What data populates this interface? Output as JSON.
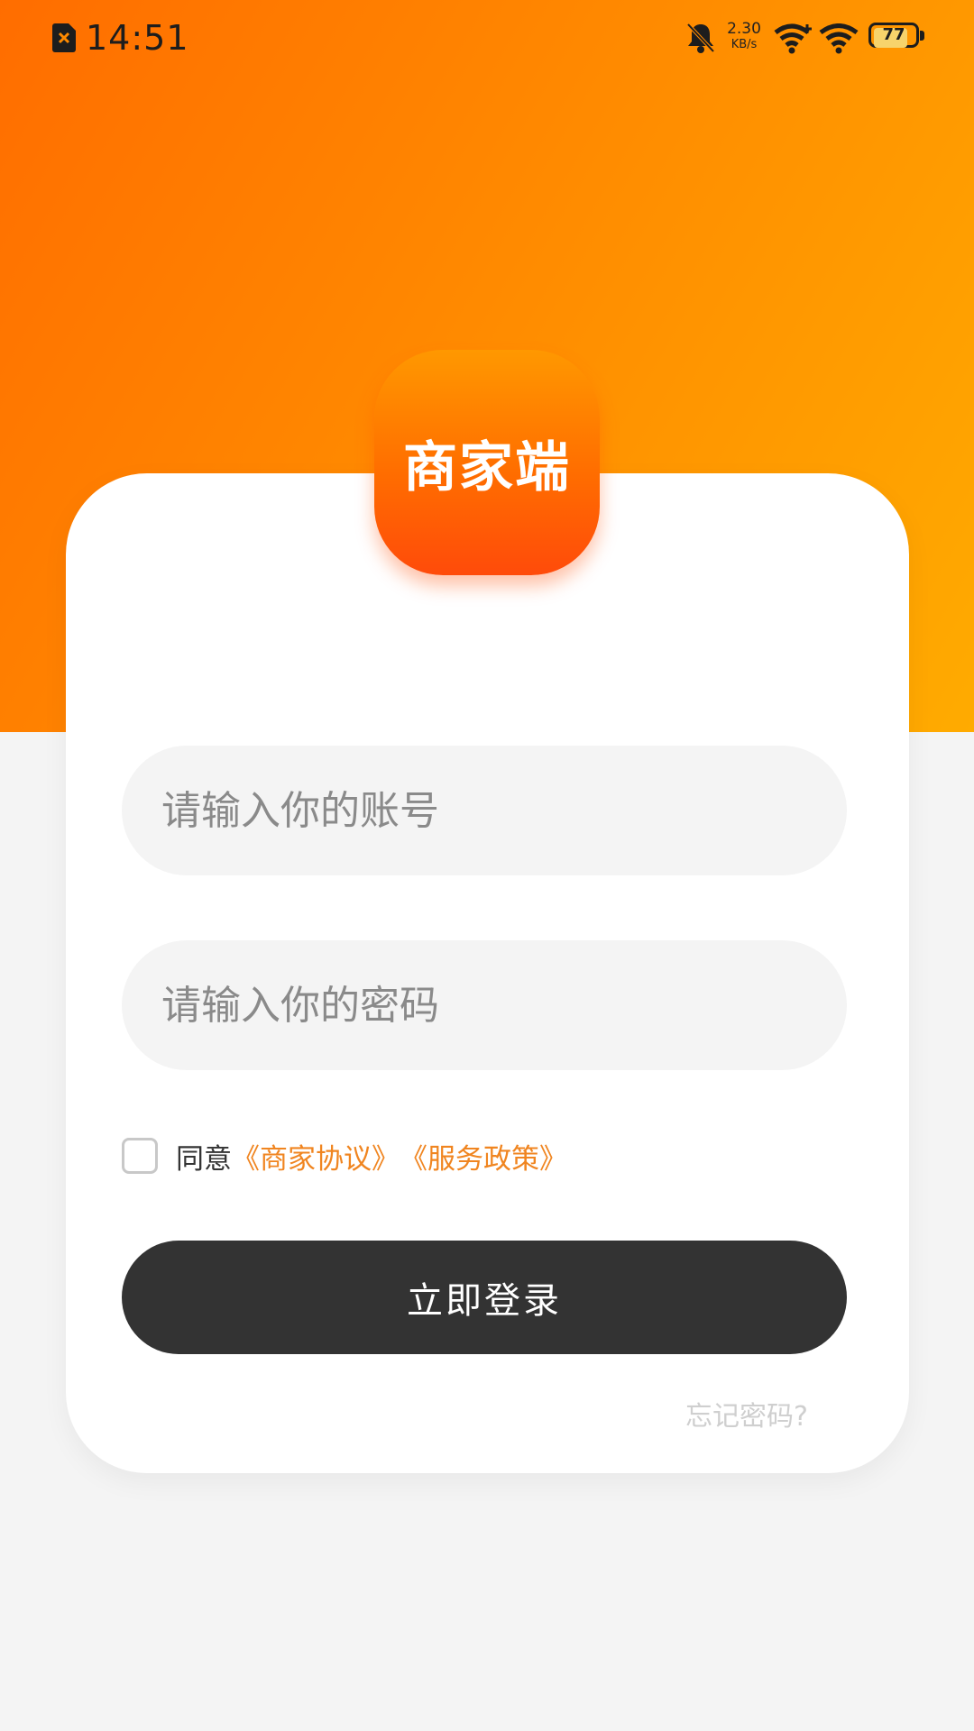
{
  "status_bar": {
    "time": "14:51",
    "net_speed_value": "2.30",
    "net_speed_unit": "KB/s",
    "battery": "77",
    "icons": [
      "sim-icon",
      "bell-muted-icon",
      "wifi-plus-icon",
      "wifi-icon",
      "battery-icon"
    ]
  },
  "logo": {
    "text": "商家端"
  },
  "form": {
    "account_placeholder": "请输入你的账号",
    "password_placeholder": "请输入你的密码",
    "agree_prefix": "同意",
    "merchant_agreement": "《商家协议》",
    "service_policy": "《服务政策》",
    "login_label": "立即登录",
    "forgot_password": "忘记密码?"
  },
  "colors": {
    "brand_orange": "#ff7a00",
    "link_orange": "#f08520",
    "button_dark": "#333333",
    "background": "#f4f4f4"
  }
}
